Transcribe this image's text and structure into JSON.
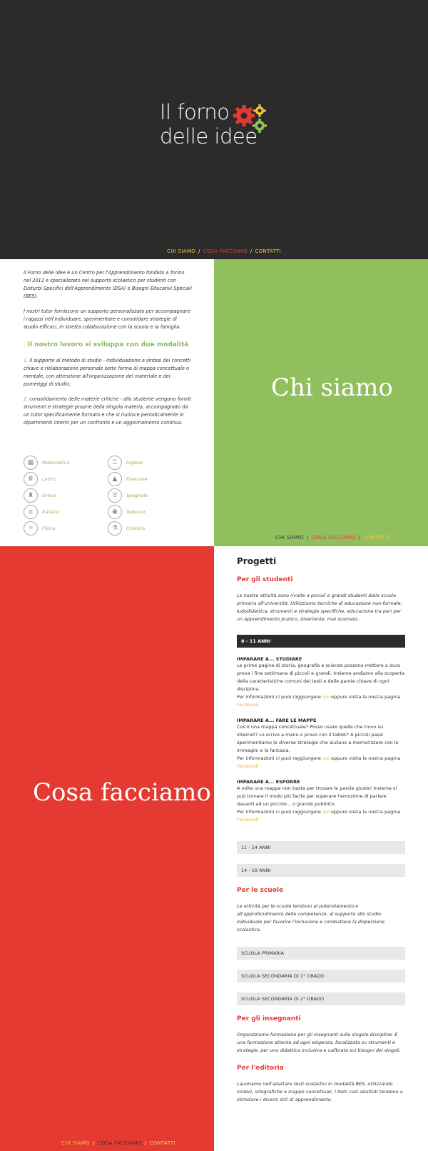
{
  "logo": {
    "line1": "Il forno",
    "line2": "delle idee"
  },
  "nav": {
    "chi": "CHI SIAMO",
    "cosa": "COSA FACCIAMO",
    "contatti": "CONTATTI",
    "sep": "/"
  },
  "chi_siamo": {
    "title": "Chi siamo",
    "p1": "Il Forno delle Idee è un Centro per l'Apprendimento fondato a Torino nel 2012 e specializzato nel supporto scolastico per studenti con Disturbi Specifici dell'Apprendimento (DSA) e Bisogni Educativi Speciali (BES).",
    "p2": "I nostri tutor forniscono un supporto personalizzato per accompagnare i ragazzi nell'individuare, sperimentare e consolidare strategie di studio efficaci, in stretta collaborazione con la scuola e la famiglia.",
    "mod_title": "Il nostro lavoro si sviluppa con due modalità",
    "m1_num": "1.",
    "m1": "Il supporto al metodo di studio - individuazione e sintesi dei concetti chiave e rielaborazione personale sotto forma di mappa concettuale o mentale, con attenzione all'organizzazione del materiale e dei pomeriggi di studio;",
    "m2_num": "2.",
    "m2": "consolidamento delle materie critiche - allo studente vengono forniti strumenti e strategie proprie della singola materia, accompagnato da un tutor specificamente formato e che si riunisce periodicamente in dipartimenti interni per un confronto e un aggiornamento continuo.",
    "subjects_left": [
      "Matematica",
      "Latino",
      "Greco",
      "Italiano",
      "Fisica"
    ],
    "subjects_right": [
      "Inglese",
      "Francese",
      "Spagnolo",
      "Tedesco",
      "Chimica"
    ]
  },
  "cosa": {
    "title": "Cosa facciamo",
    "progetti": "Progetti",
    "studenti_h": "Per gli studenti",
    "studenti_p": "Le nostre attività sono rivolte a piccoli e grandi studenti dalla scuola primaria all'università. Utilizziamo tecniche di educazione non-formale, ludodidattica, strumenti e strategie specifiche, educazione tra pari per un apprendimento pratico, divertente, mai scontato.",
    "age1": "8 - 11 ANNI",
    "i1_title": "IMPARARE A... STUDIARE",
    "i1_text": "Le prime pagine di storia, geografia e scienze possono mettere a dura prova i fine settimana di piccoli e grandi. Insieme andiamo alla scoperta della caratteristiche comuni dei testi e delle parole chiave di ogni disciplina.",
    "i2_title": "IMPARARE A... FARE LE MAPPE",
    "i2_text": "Cos'è una mappa concettuale? Posso usare quelle che trovo su internet? Lo scrivo a mano o provo con il tablet? A piccoli passi sperimentiamo le diverse strategie che aiutano a memorizzare con le immagini e la fantasia.",
    "i3_title": "IMPARARE A... ESPORRE",
    "i3_text": "A volte una mappa non basta per trovare le parole giuste! Insieme si può trovare il modo più facile per superare l'emozione di parlare davanti ad un piccolo... o grande pubblico.",
    "info_pre": "Per informazioni ci puoi raggiungere",
    "info_qui": "qui",
    "info_mid": "oppure visita la nostra pagina",
    "info_fb": "Facebook",
    "age2": "11 - 14 ANNI",
    "age3": "14 - 18 ANNI",
    "scuole_h": "Per le scuole",
    "scuole_p": "Le attività per le scuole tendono al potenziamento e all'approfondimento delle competenze, al supporto allo studio individuale per favorire l'inclusione e combattere la dispersione scolastica.",
    "s1": "SCUOLA PRIMARIA",
    "s2": "SCUOLA SECONDARIA DI 1° GRADO",
    "s3": "SCUOLA SECONDARIA DI 2° GRADO",
    "ins_h": "Per gli insegnanti",
    "ins_p": "Organizziamo formazione per gli insegnanti sulle singole discipline. È una formazione attenta ad ogni esigenza, focalizzata su strumenti e strategie, per una didattica inclusiva e calibrata sui bisogni dei singoli.",
    "edit_h": "Per l'editoria",
    "edit_p": "Lavoriamo nell'adattare testi scolastici in modalità BES, utilizzando sintesi, infografiche e mappe concettuali. I testi così adattati tendono a stimolare i diversi stili di apprendimento."
  },
  "colors": {
    "dark": "#2b2b2c",
    "green": "#91bf5e",
    "red": "#e43a31",
    "yellow": "#e9c33f"
  }
}
